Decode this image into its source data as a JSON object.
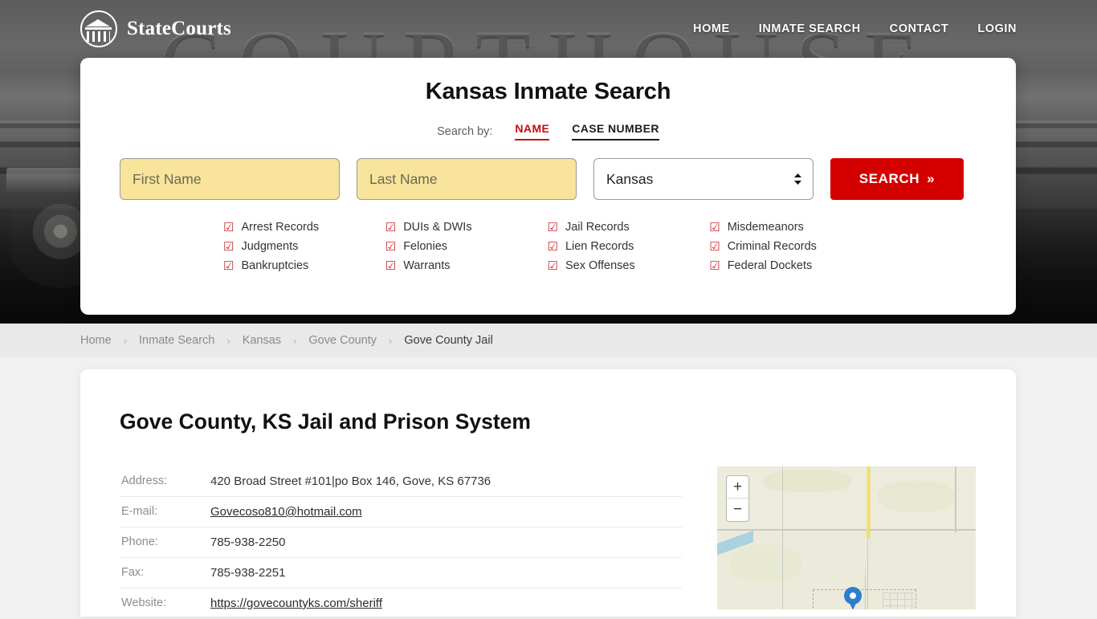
{
  "brand": {
    "name": "StateCourts",
    "logo_icon": "courthouse-circle-icon"
  },
  "nav": [
    {
      "label": "HOME",
      "name": "home"
    },
    {
      "label": "INMATE SEARCH",
      "name": "inmate-search"
    },
    {
      "label": "CONTACT",
      "name": "contact"
    },
    {
      "label": "LOGIN",
      "name": "login"
    }
  ],
  "hero": {
    "watermark": "COURTHOUSE"
  },
  "search": {
    "title": "Kansas Inmate Search",
    "search_by_label": "Search by:",
    "tabs": [
      {
        "label": "NAME",
        "active": true
      },
      {
        "label": "CASE NUMBER",
        "active": false
      }
    ],
    "first_name_placeholder": "First Name",
    "first_name_value": "",
    "last_name_placeholder": "Last Name",
    "last_name_value": "",
    "state_selected": "Kansas",
    "state_options": [
      "Kansas"
    ],
    "submit_label": "SEARCH",
    "submit_chevron": "»",
    "checkbox_glyph": "☑",
    "accent_red": "#d40000",
    "features": [
      "Arrest Records",
      "DUIs & DWIs",
      "Jail Records",
      "Misdemeanors",
      "Judgments",
      "Felonies",
      "Lien Records",
      "Criminal Records",
      "Bankruptcies",
      "Warrants",
      "Sex Offenses",
      "Federal Dockets"
    ]
  },
  "breadcrumb": {
    "separator": "›",
    "items": [
      {
        "label": "Home",
        "current": false
      },
      {
        "label": "Inmate Search",
        "current": false
      },
      {
        "label": "Kansas",
        "current": false
      },
      {
        "label": "Gove County",
        "current": false
      },
      {
        "label": "Gove County Jail",
        "current": true
      }
    ]
  },
  "page": {
    "title": "Gove County, KS Jail and Prison System",
    "details": [
      {
        "label": "Address:",
        "value": "420 Broad Street #101|po Box 146, Gove, KS 67736",
        "link": false
      },
      {
        "label": "E-mail:",
        "value": "Govecoso810@hotmail.com",
        "link": true
      },
      {
        "label": "Phone:",
        "value": "785-938-2250",
        "link": false
      },
      {
        "label": "Fax:",
        "value": "785-938-2251",
        "link": false
      },
      {
        "label": "Website:",
        "value": "https://govecountyks.com/sheriff",
        "link": true
      }
    ]
  },
  "map": {
    "zoom_in_label": "+",
    "zoom_out_label": "−",
    "marker_name": "location-pin"
  }
}
